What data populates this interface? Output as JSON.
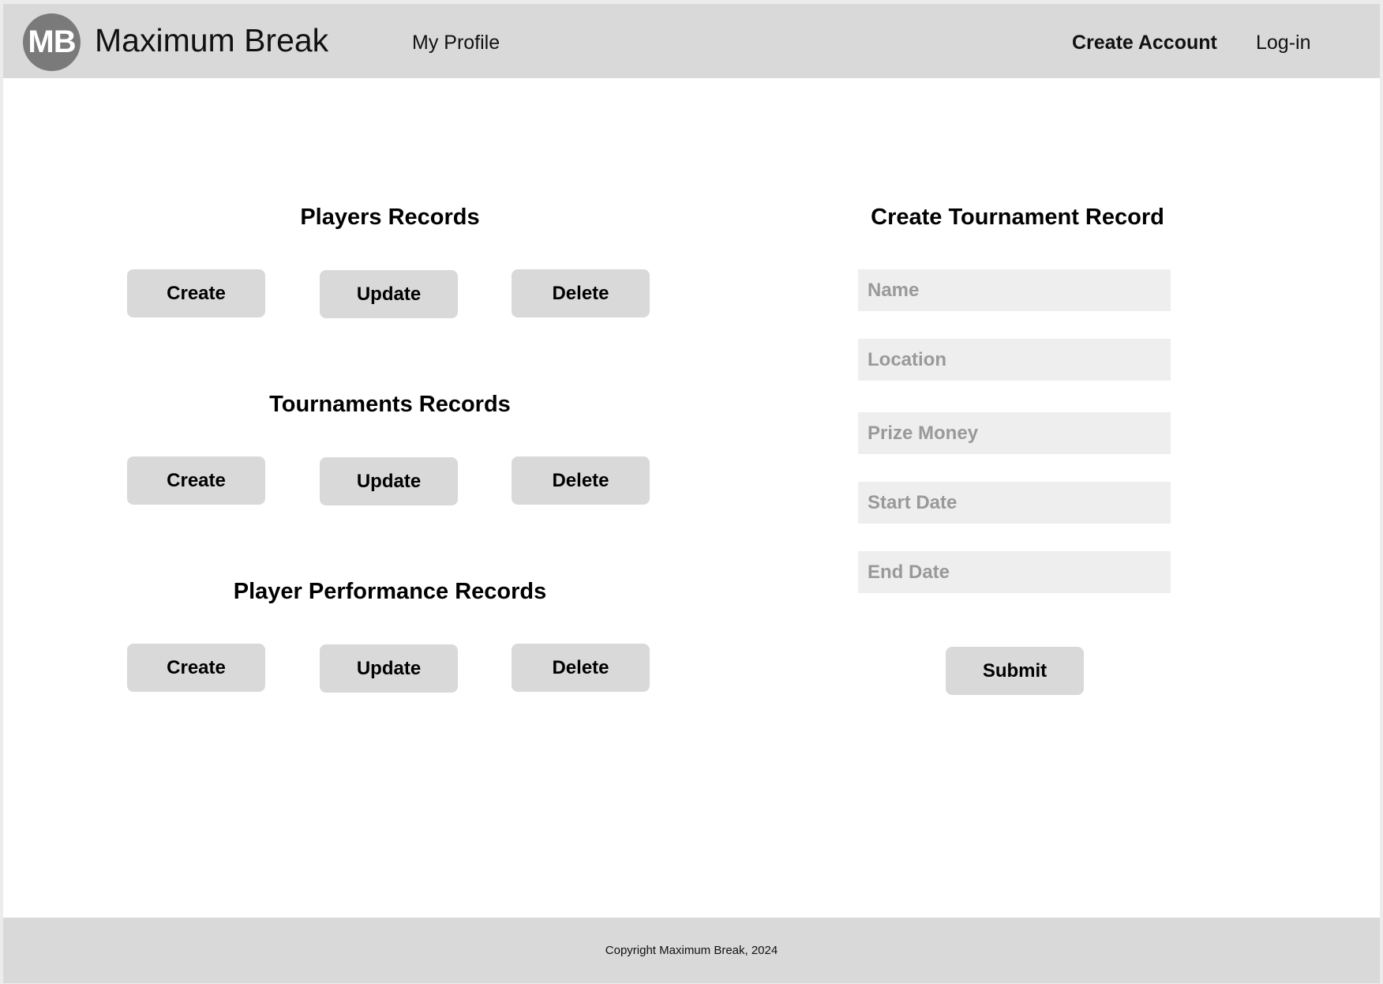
{
  "header": {
    "logo_text": "MB",
    "brand_name": "Maximum Break",
    "nav": {
      "my_profile": "My Profile",
      "create_account": "Create Account",
      "login": "Log-in"
    }
  },
  "records": {
    "players": {
      "title": "Players Records",
      "create": "Create",
      "update": "Update",
      "delete": "Delete"
    },
    "tournaments": {
      "title": "Tournaments Records",
      "create": "Create",
      "update": "Update",
      "delete": "Delete"
    },
    "performance": {
      "title": "Player Performance Records",
      "create": "Create",
      "update": "Update",
      "delete": "Delete"
    }
  },
  "form": {
    "title": "Create Tournament Record",
    "fields": {
      "name": {
        "placeholder": "Name",
        "value": ""
      },
      "location": {
        "placeholder": "Location",
        "value": ""
      },
      "prize_money": {
        "placeholder": "Prize Money",
        "value": ""
      },
      "start_date": {
        "placeholder": "Start Date",
        "value": ""
      },
      "end_date": {
        "placeholder": "End Date",
        "value": ""
      }
    },
    "submit": "Submit"
  },
  "footer": {
    "copyright": "Copyright Maximum Break, 2024"
  }
}
